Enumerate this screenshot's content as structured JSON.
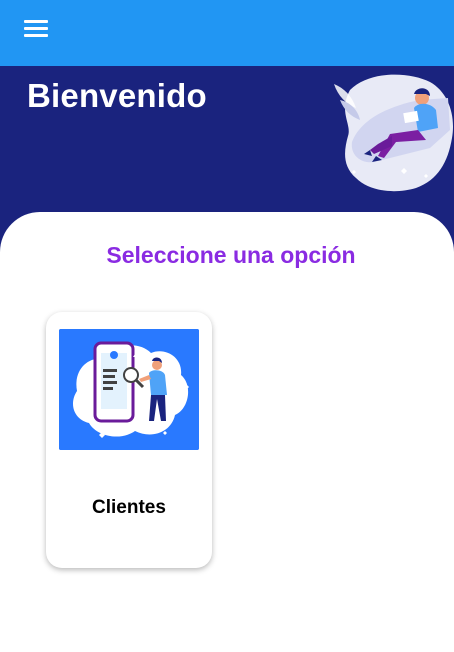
{
  "appbar": {
    "menu_icon": "hamburger-menu-icon",
    "color": "#2196f3"
  },
  "hero": {
    "title": "Bienvenido",
    "background": "#1a237e",
    "illustration": "person-reading-illustration"
  },
  "main": {
    "heading": "Seleccione una opción",
    "heading_color": "#8a2be2",
    "options": [
      {
        "label": "Clientes",
        "image": "clients-search-illustration"
      }
    ]
  }
}
